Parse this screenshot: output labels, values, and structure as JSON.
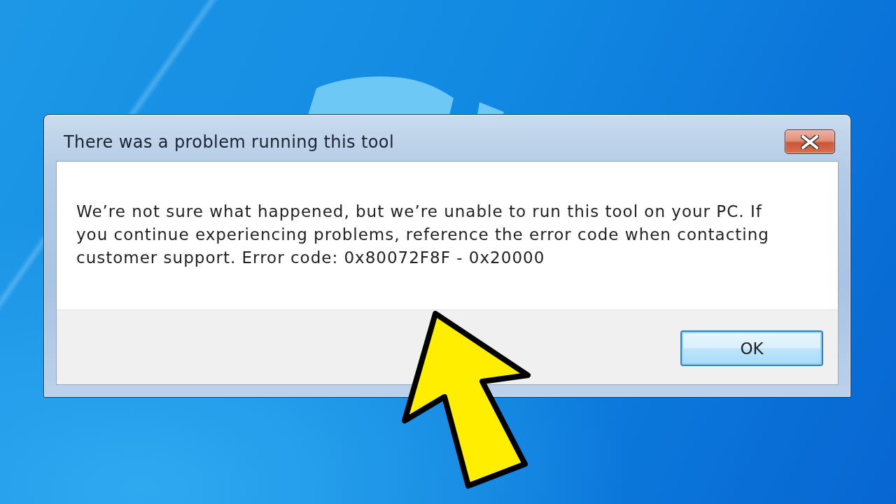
{
  "dialog": {
    "title": "There was a problem running this tool",
    "message": "We’re not sure what happened, but we’re unable to run this tool on your PC. If you continue experiencing problems, reference the error code when contacting customer support. Error code: 0x80072F8F - 0x20000",
    "buttons": [
      {
        "label": "OK",
        "default": true
      }
    ]
  }
}
